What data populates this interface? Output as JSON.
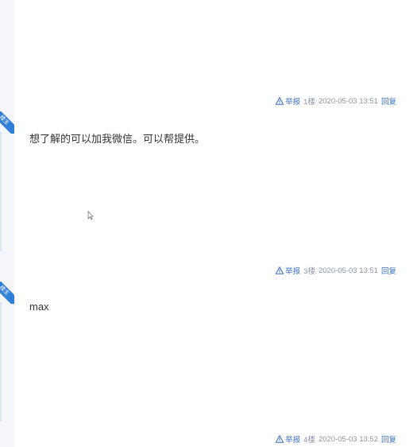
{
  "posts": [
    {
      "badge": "楼主",
      "body": "",
      "meta": {
        "report": "举报",
        "floor": "1楼",
        "time": "2020-05-03 13:51",
        "reply": "回复"
      }
    },
    {
      "badge": "楼主",
      "body": "想了解的可以加我微信。可以帮提供。",
      "meta": {
        "report": "举报",
        "floor": "3楼",
        "time": "2020-05-03 13:51",
        "reply": "回复"
      }
    },
    {
      "badge": "楼主",
      "body": "max",
      "meta": {
        "report": "举报",
        "floor": "4楼",
        "time": "2020-05-03 13:52",
        "reply": "回复"
      }
    }
  ]
}
